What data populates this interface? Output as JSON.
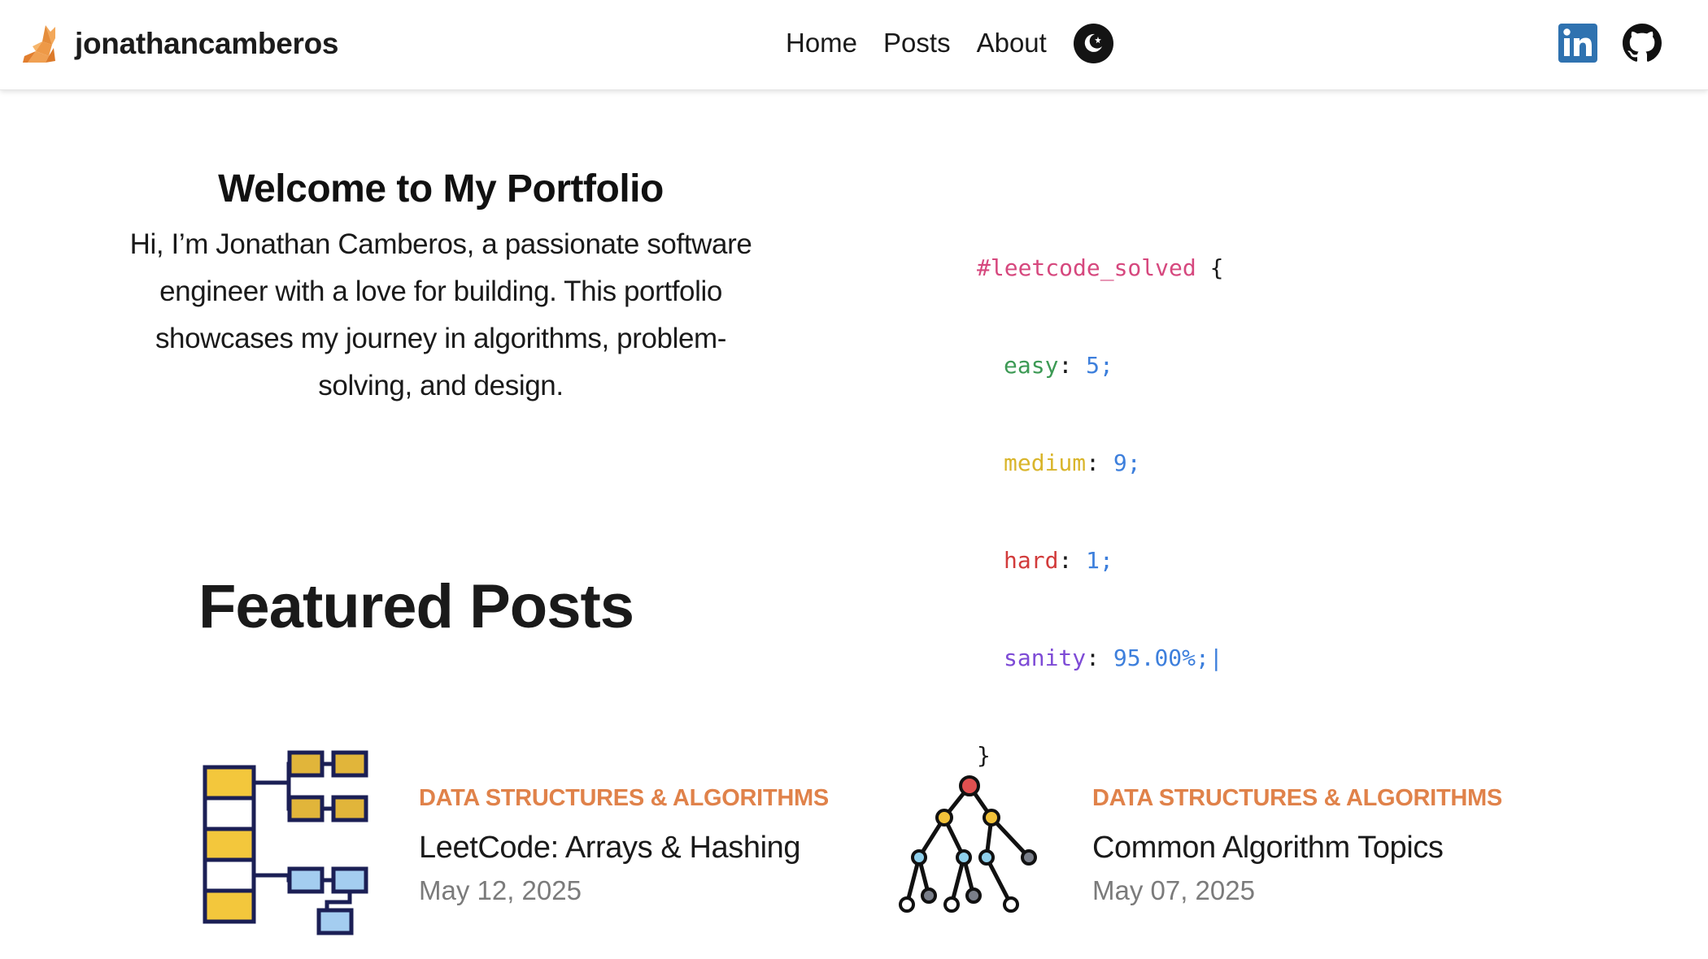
{
  "header": {
    "brand": "jonathancamberos",
    "nav": [
      "Home",
      "Posts",
      "About"
    ],
    "icons": {
      "logo": "fox-logo-icon",
      "theme": "moon-star-icon",
      "linkedin": "linkedin-icon",
      "github": "github-icon"
    }
  },
  "hero": {
    "title": "Welcome to My Portfolio",
    "text": "Hi, I’m Jonathan Camberos, a passionate software engineer with a love for building. This portfolio showcases my journey in algorithms, problem-solving, and design."
  },
  "code": {
    "selector": "#leetcode_solved",
    "open": "{",
    "close": "}",
    "props": [
      {
        "key": "easy",
        "value": "5;"
      },
      {
        "key": "medium",
        "value": "9;"
      },
      {
        "key": "hard",
        "value": "1;"
      },
      {
        "key": "sanity",
        "value": "95.00%;"
      }
    ],
    "cursor": "|"
  },
  "featured": {
    "title": "Featured Posts",
    "posts": [
      {
        "category": "DATA STRUCTURES & ALGORITHMS",
        "title": "LeetCode: Arrays & Hashing",
        "date": "May 12, 2025",
        "icon": "hash-table-icon"
      },
      {
        "category": "DATA STRUCTURES & ALGORITHMS",
        "title": "Common Algorithm Topics",
        "date": "May 07, 2025",
        "icon": "tree-graph-icon"
      }
    ]
  },
  "colors": {
    "accent": "#e0824a",
    "selector": "#d6487e",
    "easy": "#3d9a55",
    "medium": "#d9b52b",
    "hard": "#d23b3b",
    "sanity": "#7e4bd6",
    "number": "#3d7fdc"
  }
}
